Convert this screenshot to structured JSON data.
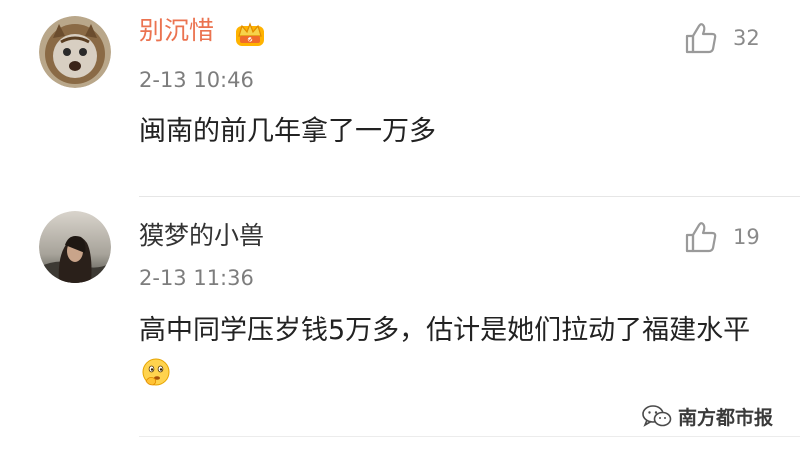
{
  "comments": [
    {
      "username": "别沉惜",
      "timestamp": "2-13 10:46",
      "text": "闽南的前几年拿了一万多",
      "likes": "32",
      "has_vip_badge": true,
      "avatar": "cat-lion-avatar"
    },
    {
      "username": "獏梦的小兽",
      "timestamp": "2-13 11:36",
      "text": "高中同学压岁钱5万多，估计是她们拉动了福建水平",
      "likes": "19",
      "has_vip_badge": false,
      "avatar": "girl-photo-avatar",
      "trailing_emoji": "thinking-emoji"
    }
  ],
  "watermark": {
    "text": "南方都市报",
    "icon": "wechat-icon"
  },
  "colors": {
    "username_vip": "#eb7350",
    "username": "#333333",
    "timestamp": "#7d7d7d",
    "text": "#222222",
    "icon": "#9a9a9a",
    "crown": "#f0b400"
  }
}
